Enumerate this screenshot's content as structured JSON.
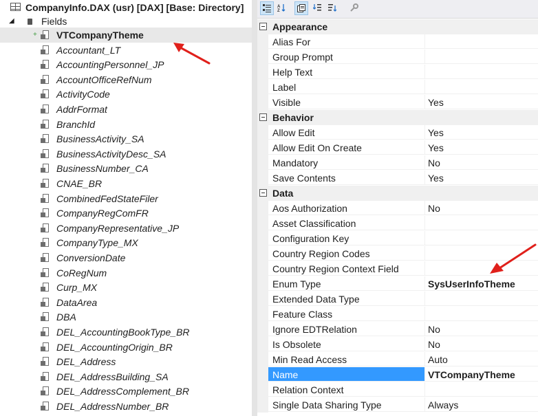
{
  "tree": {
    "root_label": "CompanyInfo.DAX (usr) [DAX] [Base: Directory]",
    "fields_label": "Fields",
    "items": [
      "VTCompanyTheme",
      "Accountant_LT",
      "AccountingPersonnel_JP",
      "AccountOfficeRefNum",
      "ActivityCode",
      "AddrFormat",
      "BranchId",
      "BusinessActivity_SA",
      "BusinessActivityDesc_SA",
      "BusinessNumber_CA",
      "CNAE_BR",
      "CombinedFedStateFiler",
      "CompanyRegComFR",
      "CompanyRepresentative_JP",
      "CompanyType_MX",
      "ConversionDate",
      "CoRegNum",
      "Curp_MX",
      "DataArea",
      "DBA",
      "DEL_AccountingBookType_BR",
      "DEL_AccountingOrigin_BR",
      "DEL_Address",
      "DEL_AddressBuilding_SA",
      "DEL_AddressComplement_BR",
      "DEL_AddressNumber_BR"
    ]
  },
  "properties": {
    "categories": [
      {
        "label": "Appearance",
        "rows": [
          {
            "name": "Alias For",
            "value": ""
          },
          {
            "name": "Group Prompt",
            "value": ""
          },
          {
            "name": "Help Text",
            "value": ""
          },
          {
            "name": "Label",
            "value": ""
          },
          {
            "name": "Visible",
            "value": "Yes"
          }
        ]
      },
      {
        "label": "Behavior",
        "rows": [
          {
            "name": "Allow Edit",
            "value": "Yes"
          },
          {
            "name": "Allow Edit On Create",
            "value": "Yes"
          },
          {
            "name": "Mandatory",
            "value": "No"
          },
          {
            "name": "Save Contents",
            "value": "Yes"
          }
        ]
      },
      {
        "label": "Data",
        "rows": [
          {
            "name": "Aos Authorization",
            "value": "No"
          },
          {
            "name": "Asset Classification",
            "value": ""
          },
          {
            "name": "Configuration Key",
            "value": ""
          },
          {
            "name": "Country Region Codes",
            "value": ""
          },
          {
            "name": "Country Region Context Field",
            "value": ""
          },
          {
            "name": "Enum Type",
            "value": "SysUserInfoTheme",
            "bold": true
          },
          {
            "name": "Extended Data Type",
            "value": ""
          },
          {
            "name": "Feature Class",
            "value": ""
          },
          {
            "name": "Ignore EDTRelation",
            "value": "No"
          },
          {
            "name": "Is Obsolete",
            "value": "No"
          },
          {
            "name": "Min Read Access",
            "value": "Auto"
          },
          {
            "name": "Name",
            "value": "VTCompanyTheme",
            "bold": true,
            "selected": true
          },
          {
            "name": "Relation Context",
            "value": ""
          },
          {
            "name": "Single Data Sharing Type",
            "value": "Always"
          }
        ]
      }
    ]
  },
  "toolbar": {
    "buttons": [
      "categorized-icon",
      "alphabetical-icon",
      "property-pages-icon",
      "expand-all-icon",
      "collapse-all-icon",
      "wrench-icon"
    ]
  },
  "colors": {
    "selection": "#3399ff",
    "arrow": "#e0201b",
    "tree_selected": "#e8e8e8"
  }
}
